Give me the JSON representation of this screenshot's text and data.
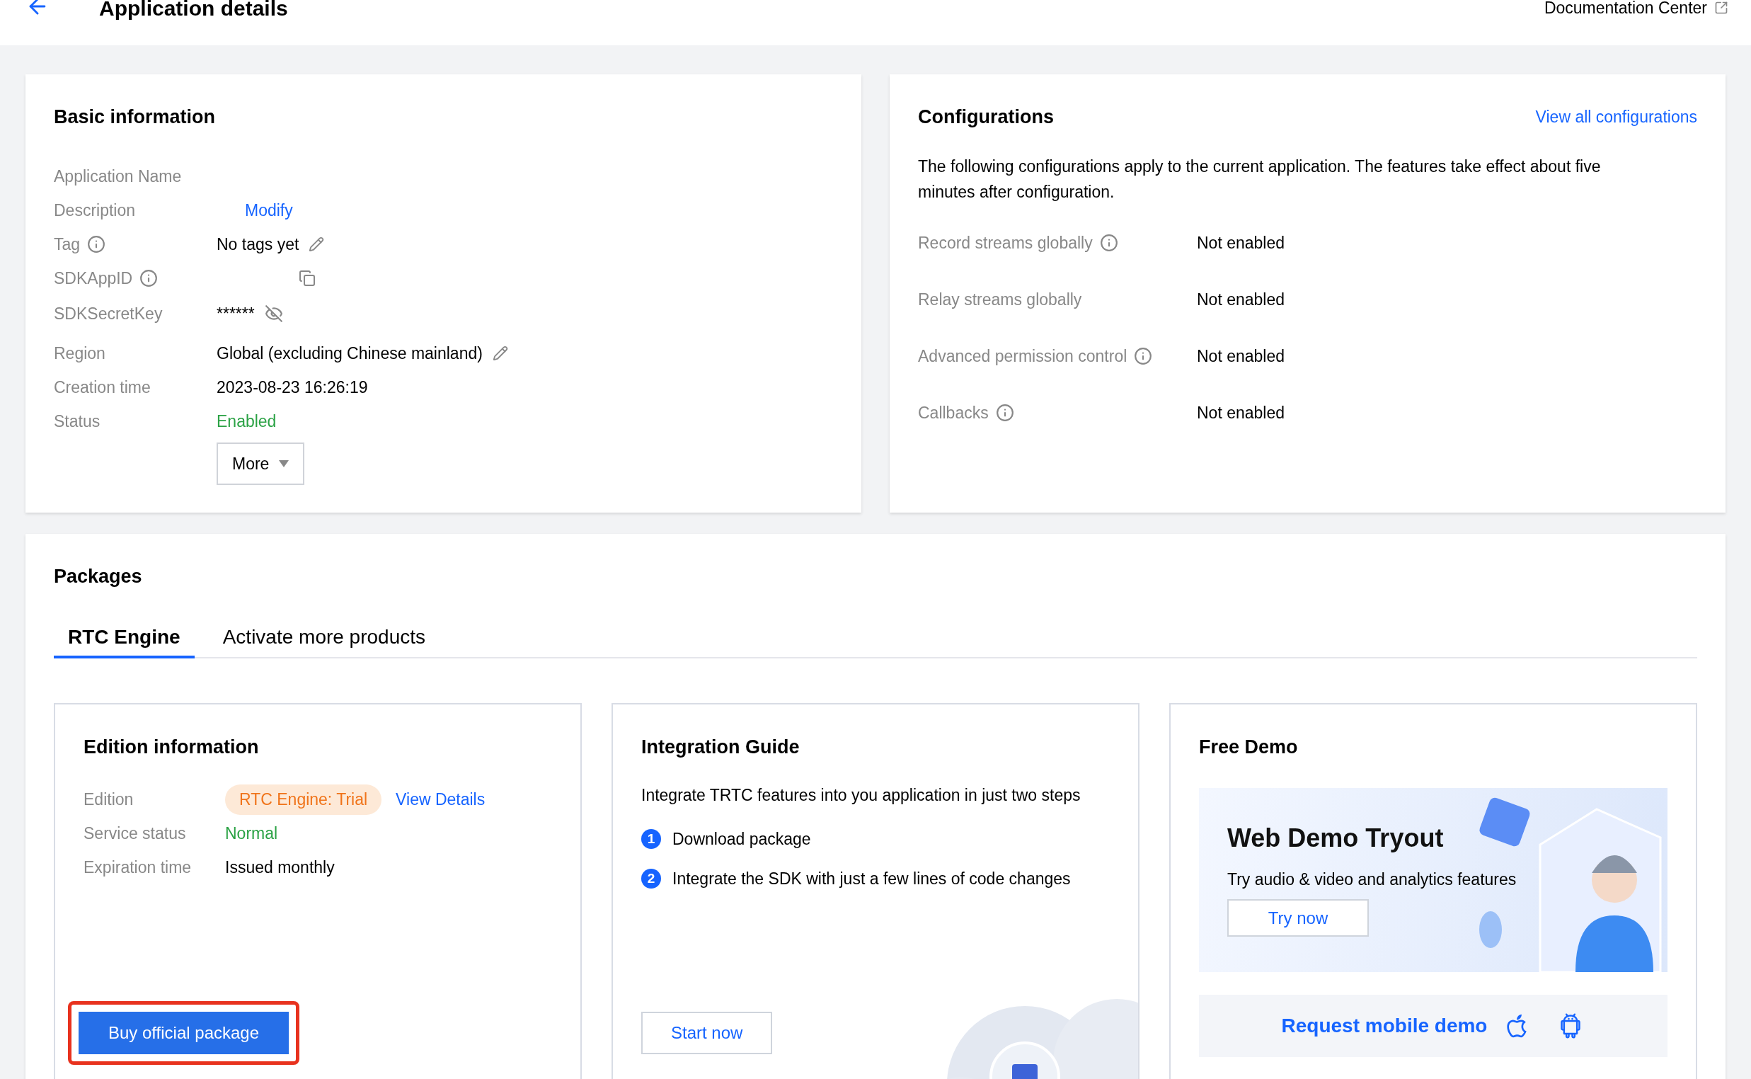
{
  "header": {
    "title": "Application details",
    "doc_link": "Documentation Center"
  },
  "basic": {
    "title": "Basic information",
    "rows": [
      {
        "kind": "label_only",
        "label": "Application Name",
        "info": false
      },
      {
        "kind": "link",
        "label": "Description",
        "info": false,
        "value": "Modify"
      },
      {
        "kind": "edit",
        "label": "Tag",
        "info": true,
        "value": "No tags yet"
      },
      {
        "kind": "copy",
        "label": "SDKAppID",
        "info": true
      },
      {
        "kind": "secret",
        "label": "SDKSecretKey",
        "info": false,
        "value": "******"
      },
      {
        "kind": "edit",
        "label": "Region",
        "info": false,
        "value": "Global (excluding Chinese mainland)"
      },
      {
        "kind": "plain",
        "label": "Creation time",
        "info": false,
        "value": "2023-08-23 16:26:19"
      },
      {
        "kind": "status",
        "label": "Status",
        "info": false,
        "value": "Enabled"
      }
    ],
    "more_button": "More"
  },
  "configurations": {
    "title": "Configurations",
    "link": "View all configurations",
    "description": "The following configurations apply to the current application. The features take effect about five minutes after configuration.",
    "rows": [
      {
        "label": "Record streams globally",
        "info": true,
        "value": "Not enabled"
      },
      {
        "label": "Relay streams globally",
        "info": false,
        "value": "Not enabled"
      },
      {
        "label": "Advanced permission control",
        "info": true,
        "value": "Not enabled"
      },
      {
        "label": "Callbacks",
        "info": true,
        "value": "Not enabled"
      }
    ]
  },
  "packages": {
    "title": "Packages",
    "tabs": [
      {
        "label": "RTC Engine",
        "selected": true
      },
      {
        "label": "Activate more products",
        "selected": false
      }
    ],
    "edition": {
      "title": "Edition information",
      "rows": [
        {
          "kind": "badge",
          "label": "Edition",
          "value": "RTC Engine: Trial",
          "link": "View Details"
        },
        {
          "kind": "status",
          "label": "Service status",
          "value": "Normal"
        },
        {
          "kind": "plain",
          "label": "Expiration time",
          "value": "Issued monthly"
        }
      ],
      "button": "Buy official package"
    },
    "guide": {
      "title": "Integration Guide",
      "intro": "Integrate TRTC features into you application in just two steps",
      "steps": [
        {
          "number": "1",
          "text": "Download package"
        },
        {
          "number": "2",
          "text": "Integrate the SDK with just a few lines of code changes"
        }
      ],
      "button": "Start now"
    },
    "demo": {
      "title": "Free Demo",
      "banner_title": "Web Demo Tryout",
      "banner_text": "Try audio & video and analytics features",
      "try_button": "Try now",
      "mobile_link": "Request mobile demo"
    }
  }
}
